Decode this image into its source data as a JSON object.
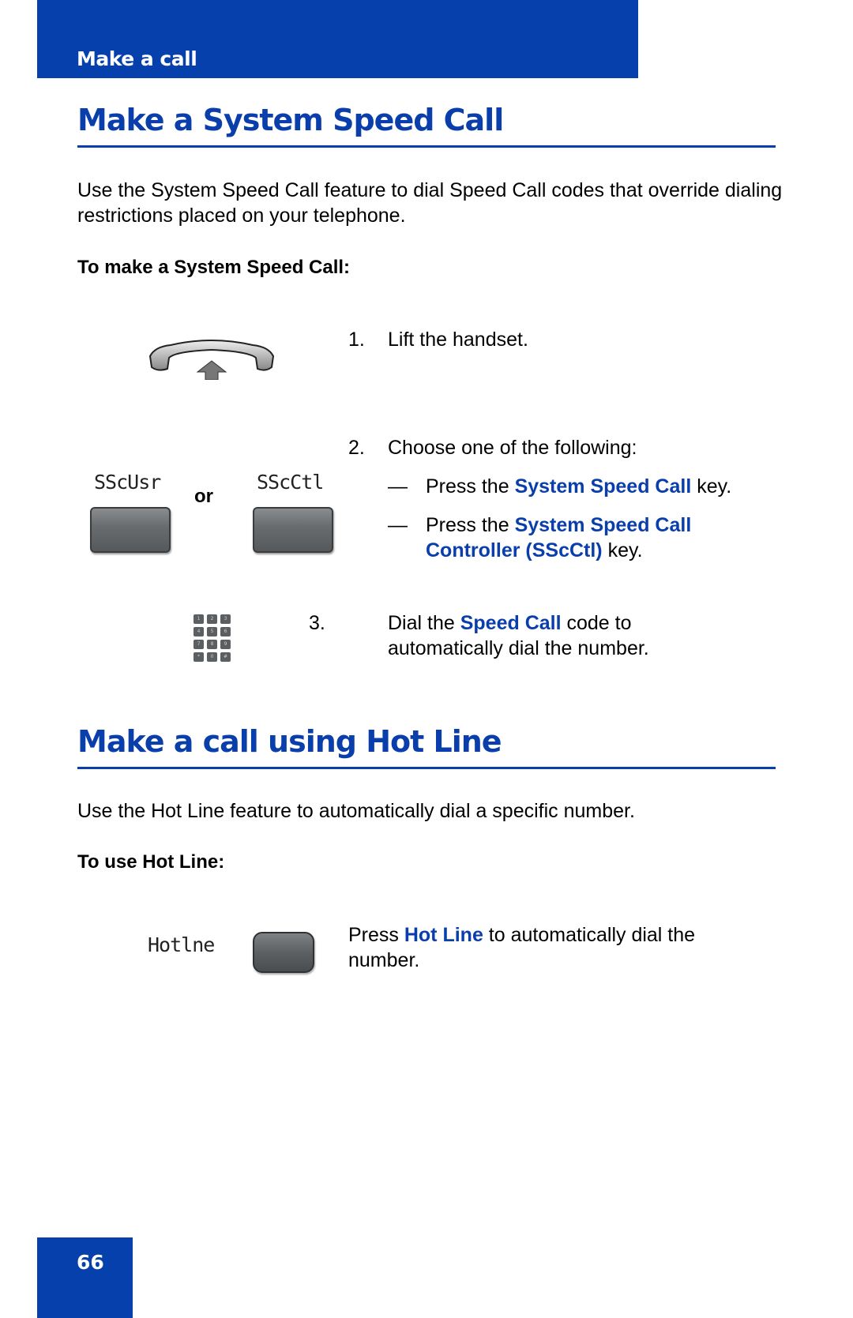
{
  "header": {
    "section": "Make a call"
  },
  "sections": [
    {
      "title": "Make a System Speed Call",
      "intro": "Use the System Speed Call feature to dial Speed Call codes that override dialing restrictions placed on your telephone.",
      "procedure_title": "To make a System Speed Call:",
      "steps": [
        {
          "num": "1.",
          "text": "Lift the handset.",
          "icon": "handset-lift-icon"
        },
        {
          "num": "2.",
          "text": "Choose one of the following:",
          "options": [
            {
              "dash": "—",
              "pre": "Press the ",
              "highlight": "System Speed Call",
              "post": " key."
            },
            {
              "dash": "—",
              "pre": "Press the ",
              "highlight": "System Speed Call Controller (SScCtl)",
              "post": " key."
            }
          ],
          "softkeys": [
            {
              "label": "SScUsr"
            },
            {
              "label": "SScCtl"
            }
          ],
          "or_label": "or"
        },
        {
          "num": "3.",
          "pre": "Dial the ",
          "highlight": "Speed Call",
          "post": " code to automatically dial the number.",
          "icon": "dialpad-icon"
        }
      ]
    },
    {
      "title": "Make a call using Hot Line",
      "intro": "Use the Hot Line feature to automatically dial a specific number.",
      "procedure_title": "To use Hot Line:",
      "step": {
        "pre": "Press ",
        "highlight": "Hot Line",
        "post": " to automatically dial the number.",
        "softkey_label": "Hotlne"
      }
    }
  ],
  "keypad": [
    "1",
    "2",
    "3",
    "4",
    "5",
    "6",
    "7",
    "8",
    "9",
    "*",
    "0",
    "#"
  ],
  "footer": {
    "page_number": "66"
  },
  "colors": {
    "brand_blue": "#0540ad",
    "heading_blue": "#0a3fab"
  }
}
